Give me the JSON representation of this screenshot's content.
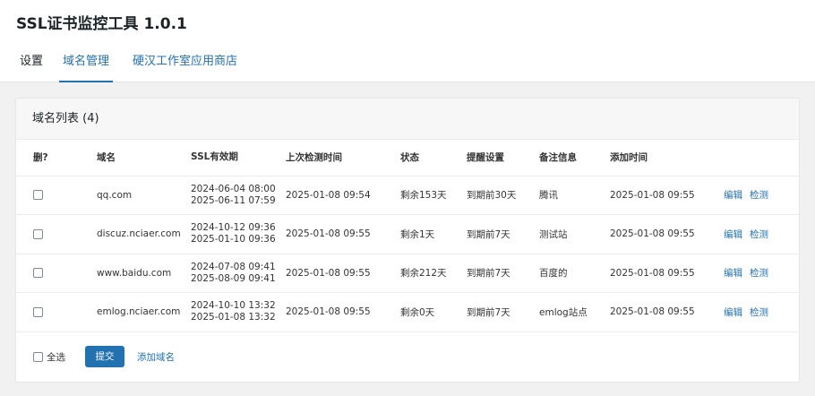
{
  "app": {
    "title": "SSL证书监控工具 1.0.1"
  },
  "tabs": [
    {
      "label": "设置"
    },
    {
      "label": "域名管理"
    },
    {
      "label": "硬汉工作室应用商店"
    }
  ],
  "panel": {
    "title": "域名列表 (4)"
  },
  "table": {
    "headers": [
      "删?",
      "域名",
      "SSL有效期",
      "上次检测时间",
      "状态",
      "提醒设置",
      "备注信息",
      "添加时间",
      ""
    ],
    "rows": [
      {
        "domain": "qq.com",
        "ssl_start": "2024-06-04 08:00",
        "ssl_end": "2025-06-11 07:59",
        "last_check": "2025-01-08 09:54",
        "status": "剩余153天",
        "remind": "到期前30天",
        "note": "腾讯",
        "added": "2025-01-08 09:55",
        "edit": "编辑",
        "check": "检测"
      },
      {
        "domain": "discuz.nciaer.com",
        "ssl_start": "2024-10-12 09:36",
        "ssl_end": "2025-01-10 09:36",
        "last_check": "2025-01-08 09:55",
        "status": "剩余1天",
        "remind": "到期前7天",
        "note": "测试站",
        "added": "2025-01-08 09:55",
        "edit": "编辑",
        "check": "检测"
      },
      {
        "domain": "www.baidu.com",
        "ssl_start": "2024-07-08 09:41",
        "ssl_end": "2025-08-09 09:41",
        "last_check": "2025-01-08 09:55",
        "status": "剩余212天",
        "remind": "到期前7天",
        "note": "百度的",
        "added": "2025-01-08 09:55",
        "edit": "编辑",
        "check": "检测"
      },
      {
        "domain": "emlog.nciaer.com",
        "ssl_start": "2024-10-10 13:32",
        "ssl_end": "2025-01-08 13:32",
        "last_check": "2025-01-08 09:55",
        "status": "剩余0天",
        "remind": "到期前7天",
        "note": "emlog站点",
        "added": "2025-01-08 09:55",
        "edit": "编辑",
        "check": "检测"
      }
    ]
  },
  "footer": {
    "select_all": "全选",
    "submit": "提交",
    "add_domain": "添加域名"
  }
}
